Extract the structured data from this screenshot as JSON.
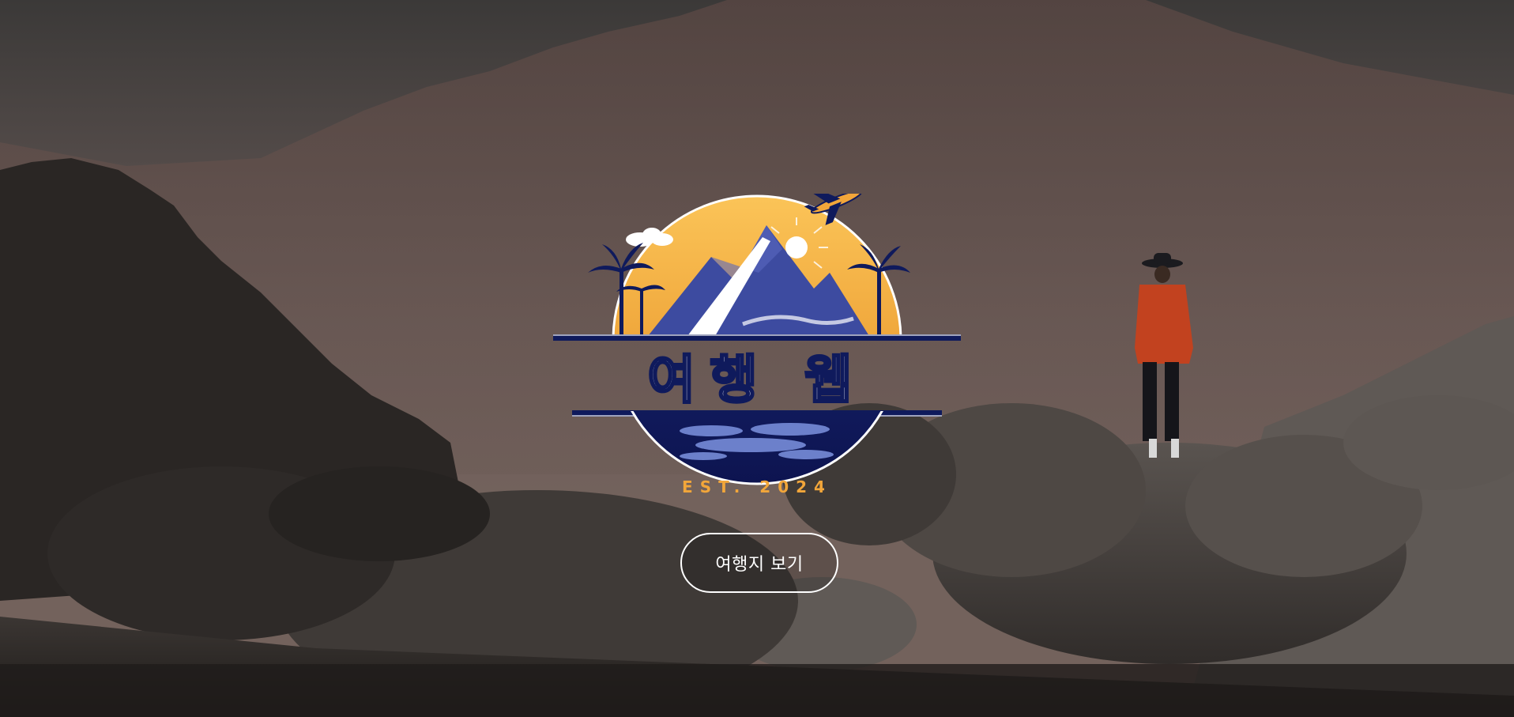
{
  "logo": {
    "title": "여행 웹",
    "est": "EST. 2024"
  },
  "cta": {
    "label": "여행지 보기"
  },
  "colors": {
    "sky_top": "#3c3a3a",
    "sky_mid": "#6a5d5a",
    "rock": "#4a4542",
    "rock_dark": "#1c1a19",
    "logo_navy": "#0f1a5c",
    "logo_orange": "#f2a63a",
    "logo_blue": "#3d4ba0",
    "button_border": "#ffffff"
  }
}
